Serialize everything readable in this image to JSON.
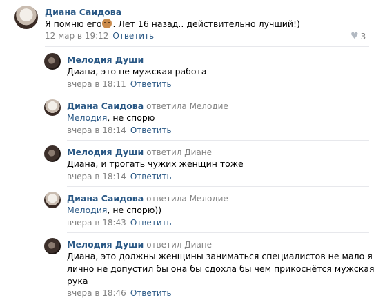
{
  "comments": [
    {
      "author": "Диана Саидова",
      "text_before": "Я помню его",
      "emoji": "monkey-emoji",
      "text_after": ". Лет 16 назад.. действительно лучший!)",
      "time": "12 мар в 19:12",
      "reply_label": "Ответить",
      "likes": "3"
    },
    {
      "author": "Мелодия Души",
      "text": "Диана, это не мужская работа",
      "time": "вчера в 18:11",
      "reply_label": "Ответить"
    },
    {
      "author": "Диана Саидова",
      "replied_to": "ответила Мелодие",
      "mention": "Мелодия",
      "text": ", не спорю",
      "time": "вчера в 18:14",
      "reply_label": "Ответить"
    },
    {
      "author": "Мелодия Души",
      "replied_to": "ответил Диане",
      "text": "Диана, и трогать чужих женщин тоже",
      "time": "вчера в 18:14",
      "reply_label": "Ответить"
    },
    {
      "author": "Диана Саидова",
      "replied_to": "ответила Мелодие",
      "mention": "Мелодия",
      "text": ", не спорю))",
      "time": "вчера в 18:43",
      "reply_label": "Ответить"
    },
    {
      "author": "Мелодия Души",
      "replied_to": "ответил Диане",
      "text_lines": [
        "Диана, это должны женщины заниматься специалистов не мало я",
        "лично не допустил бы она бы сдохла бы чем прикоснётся мужская",
        "рука"
      ],
      "time": "вчера в 18:46",
      "reply_label": "Ответить"
    }
  ]
}
